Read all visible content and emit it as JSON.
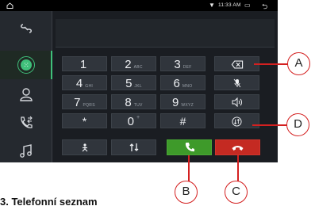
{
  "status_bar": {
    "time": "11:33 AM",
    "icons": [
      "home-icon",
      "wifi-icon",
      "recents-icon",
      "back-icon"
    ]
  },
  "sidebar": {
    "items": [
      {
        "name": "connection-icon"
      },
      {
        "name": "dialpad-icon",
        "active": true
      },
      {
        "name": "contacts-icon"
      },
      {
        "name": "call-log-icon"
      },
      {
        "name": "music-icon"
      }
    ]
  },
  "dialpad": {
    "keys": [
      {
        "digit": "1",
        "letters": ""
      },
      {
        "digit": "2",
        "letters": "ABC"
      },
      {
        "digit": "3",
        "letters": "DEF"
      },
      {
        "digit": "4",
        "letters": "GHI"
      },
      {
        "digit": "5",
        "letters": "JKL"
      },
      {
        "digit": "6",
        "letters": "MNO"
      },
      {
        "digit": "7",
        "letters": "PQRS"
      },
      {
        "digit": "8",
        "letters": "TUV"
      },
      {
        "digit": "9",
        "letters": "WXYZ"
      },
      {
        "digit": "*",
        "letters": ""
      },
      {
        "digit": "0",
        "letters": "+"
      },
      {
        "digit": "#",
        "letters": ""
      }
    ],
    "side_buttons": [
      "backspace-icon",
      "mute-mic-icon",
      "speaker-icon",
      "transfer-icon"
    ],
    "bottom_buttons": [
      "person-icon",
      "swap-icon",
      "call-icon",
      "hangup-icon"
    ],
    "colors": {
      "call": "#3e9a2a",
      "hangup": "#c42a22",
      "accent": "#3fbf7a"
    }
  },
  "callouts": {
    "a": "A",
    "b": "B",
    "c": "C",
    "d": "D"
  },
  "caption": "3. Telefonní seznam"
}
